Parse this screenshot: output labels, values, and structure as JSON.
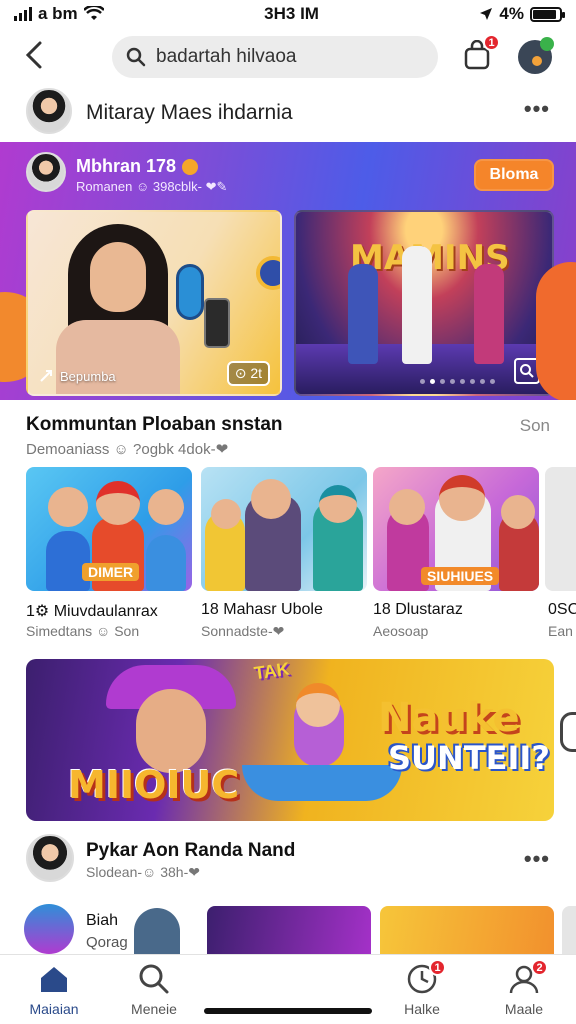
{
  "status_bar": {
    "carrier": "a bm",
    "time": "3H3 IM",
    "battery": "4%"
  },
  "search": {
    "value": "badartah hilvaoa"
  },
  "notifications": {
    "badge": "1"
  },
  "channel": {
    "name": "Mitaray Maes ihdarnia",
    "more": "•••"
  },
  "hero": {
    "title": "Mbhran 178",
    "subtitle": "Romanen ☺ 398cblk- ❤✎",
    "button": "Bloma",
    "card1": {
      "label": "Bepumba",
      "count": "⊙ 2t"
    },
    "card2": {
      "stage_text": "MAMINS"
    }
  },
  "section": {
    "title": "Kommuntan Ploaban snstan",
    "subtitle": "Demoaniass ☺ ?ogbk 4dok-❤",
    "side": "Son"
  },
  "tiles": [
    {
      "banner": "DIMER",
      "caption": "1⚙ Miuvdaulanrax",
      "sub": "Simedtans ☺ Son"
    },
    {
      "banner": "",
      "caption": "18 Mahasr Ubole",
      "sub": "Sonnadste-❤"
    },
    {
      "banner": "SIUHIUES",
      "caption": "18 Dlustaraz",
      "sub": "Aeosoap"
    },
    {
      "banner": "",
      "caption": "0SC",
      "sub": "Ean"
    }
  ],
  "promo": {
    "left_text": "MIIOIUC",
    "right_title": "Nauke",
    "right_sub": "SUNTEII?",
    "sticker": "TAK"
  },
  "channel2": {
    "name": "Pykar Aon Randa Nand",
    "sub": "Slodean-☺ 38h-❤",
    "more": "•••"
  },
  "row2": {
    "label1": "Biah",
    "label2": "Qorag"
  },
  "nav": [
    {
      "label": "Maiaian",
      "icon": "home-icon",
      "active": true
    },
    {
      "label": "Meneie",
      "icon": "search-icon",
      "active": false
    },
    {
      "label": "Halke",
      "icon": "clock-icon",
      "active": false,
      "badge": "1"
    },
    {
      "label": "Maale",
      "icon": "profile-icon",
      "active": false,
      "badge": "2"
    }
  ],
  "colors": {
    "accent": "#f5852a",
    "nav_active": "#2a4a8a",
    "badge": "#e3262e"
  }
}
